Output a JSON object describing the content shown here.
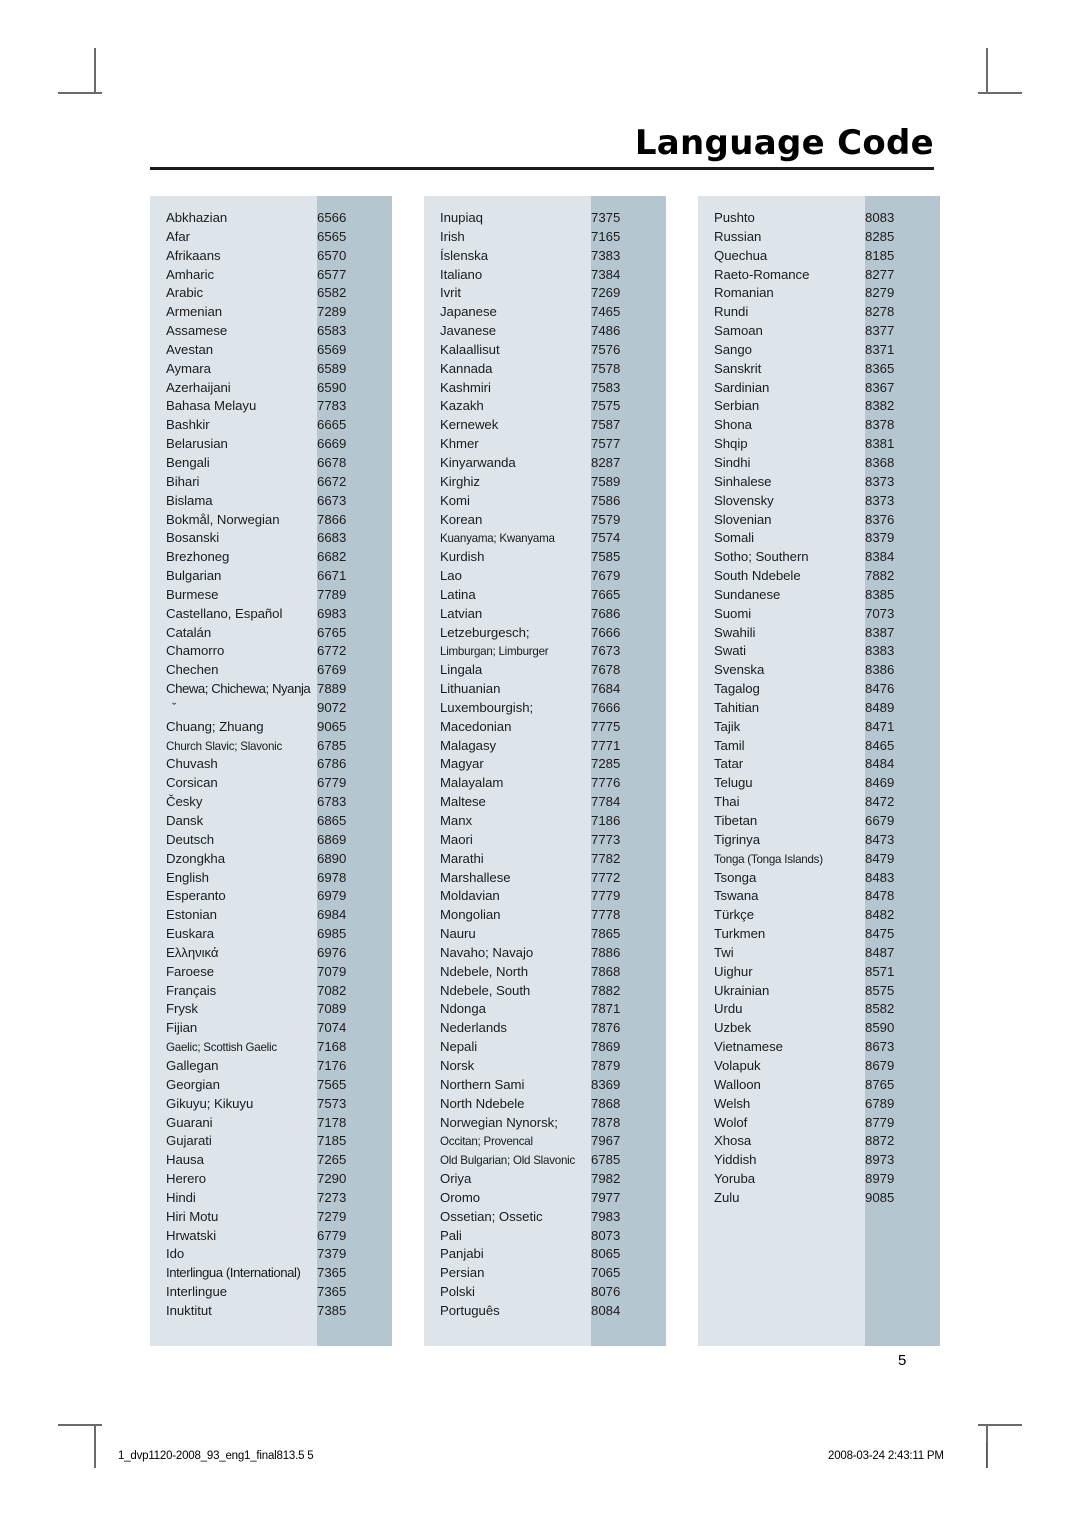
{
  "header": {
    "title": "Language Code"
  },
  "page_number": "5",
  "footer": {
    "left": "1_dvp1120-2008_93_eng1_final813.5   5",
    "right": "2008-03-24   2:43:11 PM"
  },
  "colors": {
    "name_cell_bg": "#dde5ea",
    "code_cell_bg": "#b6c6d0",
    "text": "#1c1c1c",
    "rule": "#1a1a1a",
    "crop_mark": "#6b6b6b"
  },
  "table": {
    "columns": [
      {
        "id": "column-1",
        "rows": [
          {
            "language": "Abkhazian",
            "code": "6566"
          },
          {
            "language": "Afar",
            "code": "6565"
          },
          {
            "language": "Afrikaans",
            "code": "6570"
          },
          {
            "language": "Amharic",
            "code": "6577"
          },
          {
            "language": "Arabic",
            "code": "6582"
          },
          {
            "language": "Armenian",
            "code": "7289"
          },
          {
            "language": "Assamese",
            "code": "6583"
          },
          {
            "language": "Avestan",
            "code": "6569"
          },
          {
            "language": "Aymara",
            "code": "6589"
          },
          {
            "language": "Azerhaijani",
            "code": "6590"
          },
          {
            "language": "Bahasa Melayu",
            "code": "7783"
          },
          {
            "language": "Bashkir",
            "code": "6665"
          },
          {
            "language": "Belarusian",
            "code": "6669"
          },
          {
            "language": "Bengali",
            "code": "6678"
          },
          {
            "language": "Bihari",
            "code": "6672"
          },
          {
            "language": "Bislama",
            "code": "6673"
          },
          {
            "language": "Bokmål, Norwegian",
            "code": "7866"
          },
          {
            "language": "Bosanski",
            "code": "6683"
          },
          {
            "language": "Brezhoneg",
            "code": "6682"
          },
          {
            "language": "Bulgarian",
            "code": "6671"
          },
          {
            "language": "Burmese",
            "code": "7789"
          },
          {
            "language": "Castellano, Español",
            "code": "6983"
          },
          {
            "language": "Catalán",
            "code": "6765"
          },
          {
            "language": "Chamorro",
            "code": "6772"
          },
          {
            "language": "Chechen",
            "code": "6769"
          },
          {
            "language": "Chewa; Chichewa; Nyanja",
            "code": "7889",
            "style": "squeeze"
          },
          {
            "language": "ˇ",
            "code": "9072",
            "style": "diacritic"
          },
          {
            "language": "Chuang; Zhuang",
            "code": "9065"
          },
          {
            "language": "Church Slavic; Slavonic",
            "code": "6785",
            "style": "tight"
          },
          {
            "language": "Chuvash",
            "code": "6786"
          },
          {
            "language": "Corsican",
            "code": "6779"
          },
          {
            "language": "Česky",
            "code": "6783"
          },
          {
            "language": "Dansk",
            "code": "6865"
          },
          {
            "language": "Deutsch",
            "code": "6869"
          },
          {
            "language": "Dzongkha",
            "code": "6890"
          },
          {
            "language": "English",
            "code": "6978"
          },
          {
            "language": "Esperanto",
            "code": "6979"
          },
          {
            "language": "Estonian",
            "code": "6984"
          },
          {
            "language": "Euskara",
            "code": "6985"
          },
          {
            "language": "Ελληνικά",
            "code": "6976"
          },
          {
            "language": "Faroese",
            "code": "7079"
          },
          {
            "language": "Français",
            "code": "7082"
          },
          {
            "language": "Frysk",
            "code": "7089"
          },
          {
            "language": "Fijian",
            "code": "7074"
          },
          {
            "language": "Gaelic; Scottish Gaelic",
            "code": "7168",
            "style": "tight"
          },
          {
            "language": "Gallegan",
            "code": "7176"
          },
          {
            "language": "Georgian",
            "code": "7565"
          },
          {
            "language": "Gikuyu; Kikuyu",
            "code": "7573"
          },
          {
            "language": "Guarani",
            "code": "7178"
          },
          {
            "language": "Gujarati",
            "code": "7185"
          },
          {
            "language": "Hausa",
            "code": "7265"
          },
          {
            "language": "Herero",
            "code": "7290"
          },
          {
            "language": "Hindi",
            "code": "7273"
          },
          {
            "language": "Hiri Motu",
            "code": "7279"
          },
          {
            "language": "Hrwatski",
            "code": "6779"
          },
          {
            "language": "Ido",
            "code": "7379"
          },
          {
            "language": "Interlingua (International)",
            "code": "7365",
            "style": "squeeze"
          },
          {
            "language": "Interlingue",
            "code": "7365"
          },
          {
            "language": "Inuktitut",
            "code": "7385"
          }
        ]
      },
      {
        "id": "column-2",
        "rows": [
          {
            "language": "Inupiaq",
            "code": "7375"
          },
          {
            "language": "Irish",
            "code": "7165"
          },
          {
            "language": "Íslenska",
            "code": "7383"
          },
          {
            "language": "Italiano",
            "code": "7384"
          },
          {
            "language": "Ivrit",
            "code": "7269"
          },
          {
            "language": "Japanese",
            "code": "7465"
          },
          {
            "language": "Javanese",
            "code": "7486"
          },
          {
            "language": "Kalaallisut",
            "code": "7576"
          },
          {
            "language": "Kannada",
            "code": "7578"
          },
          {
            "language": "Kashmiri",
            "code": "7583"
          },
          {
            "language": "Kazakh",
            "code": "7575"
          },
          {
            "language": "Kernewek",
            "code": "7587"
          },
          {
            "language": "Khmer",
            "code": "7577"
          },
          {
            "language": "Kinyarwanda",
            "code": "8287"
          },
          {
            "language": "Kirghiz",
            "code": "7589"
          },
          {
            "language": "Komi",
            "code": "7586"
          },
          {
            "language": "Korean",
            "code": "7579"
          },
          {
            "language": "Kuanyama; Kwanyama",
            "code": "7574",
            "style": "tight"
          },
          {
            "language": "Kurdish",
            "code": "7585"
          },
          {
            "language": "Lao",
            "code": "7679"
          },
          {
            "language": "Latina",
            "code": "7665"
          },
          {
            "language": "Latvian",
            "code": "7686"
          },
          {
            "language": "Letzeburgesch;",
            "code": "7666"
          },
          {
            "language": "Limburgan; Limburger",
            "code": "7673",
            "style": "tight"
          },
          {
            "language": "Lingala",
            "code": "7678"
          },
          {
            "language": "Lithuanian",
            "code": "7684"
          },
          {
            "language": "Luxembourgish;",
            "code": "7666"
          },
          {
            "language": "Macedonian",
            "code": "7775"
          },
          {
            "language": "Malagasy",
            "code": "7771"
          },
          {
            "language": "Magyar",
            "code": "7285"
          },
          {
            "language": "Malayalam",
            "code": "7776"
          },
          {
            "language": "Maltese",
            "code": "7784"
          },
          {
            "language": "Manx",
            "code": "7186"
          },
          {
            "language": "Maori",
            "code": "7773"
          },
          {
            "language": "Marathi",
            "code": "7782"
          },
          {
            "language": "Marshallese",
            "code": "7772"
          },
          {
            "language": "Moldavian",
            "code": "7779"
          },
          {
            "language": "Mongolian",
            "code": "7778"
          },
          {
            "language": "Nauru",
            "code": "7865"
          },
          {
            "language": "Navaho; Navajo",
            "code": "7886"
          },
          {
            "language": "Ndebele, North",
            "code": "7868"
          },
          {
            "language": "Ndebele, South",
            "code": "7882"
          },
          {
            "language": "Ndonga",
            "code": "7871"
          },
          {
            "language": "Nederlands",
            "code": "7876"
          },
          {
            "language": "Nepali",
            "code": "7869"
          },
          {
            "language": "Norsk",
            "code": "7879"
          },
          {
            "language": "Northern Sami",
            "code": "8369"
          },
          {
            "language": "North Ndebele",
            "code": "7868"
          },
          {
            "language": "Norwegian Nynorsk;",
            "code": "7878"
          },
          {
            "language": "Occitan; Provencal",
            "code": "7967",
            "style": "tight"
          },
          {
            "language": "Old Bulgarian; Old Slavonic",
            "code": "6785",
            "style": "tight"
          },
          {
            "language": "Oriya",
            "code": "7982"
          },
          {
            "language": "Oromo",
            "code": "7977"
          },
          {
            "language": "Ossetian; Ossetic",
            "code": "7983"
          },
          {
            "language": "Pali",
            "code": "8073"
          },
          {
            "language": "Panjabi",
            "code": "8065"
          },
          {
            "language": "Persian",
            "code": "7065"
          },
          {
            "language": "Polski",
            "code": "8076"
          },
          {
            "language": "Português",
            "code": "8084"
          }
        ]
      },
      {
        "id": "column-3",
        "rows": [
          {
            "language": "Pushto",
            "code": "8083"
          },
          {
            "language": "Russian",
            "code": "8285"
          },
          {
            "language": "Quechua",
            "code": "8185"
          },
          {
            "language": "Raeto-Romance",
            "code": "8277"
          },
          {
            "language": "Romanian",
            "code": "8279"
          },
          {
            "language": "Rundi",
            "code": "8278"
          },
          {
            "language": "Samoan",
            "code": "8377"
          },
          {
            "language": "Sango",
            "code": "8371"
          },
          {
            "language": "Sanskrit",
            "code": "8365"
          },
          {
            "language": "Sardinian",
            "code": "8367"
          },
          {
            "language": "Serbian",
            "code": "8382"
          },
          {
            "language": "Shona",
            "code": "8378"
          },
          {
            "language": "Shqip",
            "code": "8381"
          },
          {
            "language": "Sindhi",
            "code": "8368"
          },
          {
            "language": "Sinhalese",
            "code": "8373"
          },
          {
            "language": "Slovensky",
            "code": "8373"
          },
          {
            "language": "Slovenian",
            "code": "8376"
          },
          {
            "language": "Somali",
            "code": "8379"
          },
          {
            "language": "Sotho; Southern",
            "code": "8384"
          },
          {
            "language": "South Ndebele",
            "code": "7882"
          },
          {
            "language": "Sundanese",
            "code": "8385"
          },
          {
            "language": "Suomi",
            "code": "7073"
          },
          {
            "language": "Swahili",
            "code": "8387"
          },
          {
            "language": "Swati",
            "code": "8383"
          },
          {
            "language": "Svenska",
            "code": "8386"
          },
          {
            "language": "Tagalog",
            "code": "8476"
          },
          {
            "language": "Tahitian",
            "code": "8489"
          },
          {
            "language": "Tajik",
            "code": "8471"
          },
          {
            "language": "Tamil",
            "code": "8465"
          },
          {
            "language": "Tatar",
            "code": "8484"
          },
          {
            "language": "Telugu",
            "code": "8469"
          },
          {
            "language": "Thai",
            "code": "8472"
          },
          {
            "language": "Tibetan",
            "code": "6679"
          },
          {
            "language": "Tigrinya",
            "code": "8473"
          },
          {
            "language": "Tonga (Tonga Islands)",
            "code": "8479",
            "style": "tight"
          },
          {
            "language": "Tsonga",
            "code": "8483"
          },
          {
            "language": "Tswana",
            "code": "8478"
          },
          {
            "language": "Türkçe",
            "code": "8482"
          },
          {
            "language": "Turkmen",
            "code": "8475"
          },
          {
            "language": "Twi",
            "code": "8487"
          },
          {
            "language": "Uighur",
            "code": "8571"
          },
          {
            "language": "Ukrainian",
            "code": "8575"
          },
          {
            "language": "Urdu",
            "code": "8582"
          },
          {
            "language": "Uzbek",
            "code": "8590"
          },
          {
            "language": "Vietnamese",
            "code": "8673"
          },
          {
            "language": "Volapuk",
            "code": "8679"
          },
          {
            "language": "Walloon",
            "code": "8765"
          },
          {
            "language": "Welsh",
            "code": "6789"
          },
          {
            "language": "Wolof",
            "code": "8779"
          },
          {
            "language": "Xhosa",
            "code": "8872"
          },
          {
            "language": "Yiddish",
            "code": "8973"
          },
          {
            "language": "Yoruba",
            "code": "8979"
          },
          {
            "language": "Zulu",
            "code": "9085"
          }
        ]
      }
    ]
  }
}
